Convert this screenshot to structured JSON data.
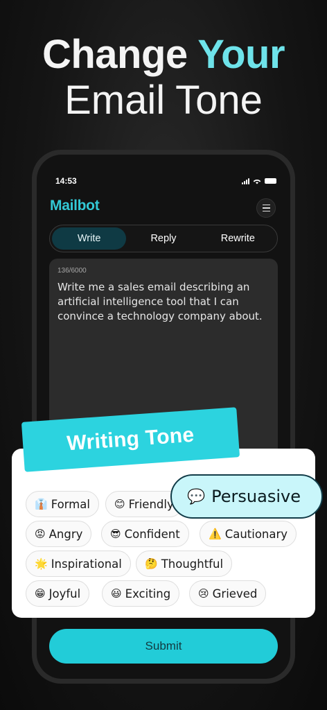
{
  "headline": {
    "line1_a": "Change",
    "line1_b": "Your",
    "line2": "Email Tone"
  },
  "status": {
    "time": "14:53"
  },
  "app": {
    "name": "Mailbot"
  },
  "tabs": [
    {
      "label": "Write",
      "active": true
    },
    {
      "label": "Reply"
    },
    {
      "label": "Rewrite"
    }
  ],
  "compose": {
    "counter": "136/6000",
    "text": "Write me a sales email describing an artificial intelligence tool that I can convince a technology company about."
  },
  "tone": {
    "banner": "Writing Tone",
    "highlight": {
      "emoji": "💬",
      "label": "Persuasive"
    },
    "chips": [
      {
        "emoji": "👔",
        "label": "Formal"
      },
      {
        "emoji": "😊",
        "label": "Friendly"
      },
      {
        "emoji": "😡",
        "label": "Angry"
      },
      {
        "emoji": "😎",
        "label": "Confident"
      },
      {
        "emoji": "⚠️",
        "label": "Cautionary"
      },
      {
        "emoji": "🌟",
        "label": "Inspirational"
      },
      {
        "emoji": "🤔",
        "label": "Thoughtful"
      },
      {
        "emoji": "😁",
        "label": "Joyful"
      },
      {
        "emoji": "😃",
        "label": "Exciting"
      },
      {
        "emoji": "😢",
        "label": "Grieved"
      }
    ]
  },
  "submit_label": "Submit",
  "colors": {
    "accent": "#22ccd8",
    "headline_accent": "#6ee3ea",
    "tab_active": "#0f3a44"
  }
}
